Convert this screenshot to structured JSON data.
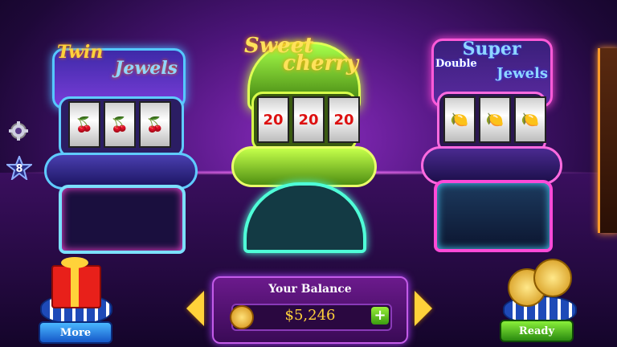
{
  "machines": [
    {
      "title_line1": "Twin",
      "title_line2": "Jewels",
      "reels": [
        "🍒",
        "🍒",
        "🍒"
      ]
    },
    {
      "title_line1": "Sweet",
      "title_line2": "cherry",
      "reels": [
        "20",
        "20",
        "20"
      ]
    },
    {
      "title_line1": "Super",
      "title_line2": "Double",
      "title_line3": "Jewels",
      "reels": [
        "🍋",
        "🍋",
        "🍋"
      ]
    }
  ],
  "sidebar": {
    "level": "8"
  },
  "balance": {
    "label": "Your Balance",
    "amount": "$5,246",
    "add_symbol": "+"
  },
  "buttons": {
    "more_label": "More",
    "ready_label": "Ready"
  },
  "icons": {
    "settings": "gear-icon",
    "level": "star-icon",
    "coin": "coin-icon",
    "gift": "gift-icon",
    "left": "left-arrow-icon",
    "right": "right-arrow-icon"
  },
  "colors": {
    "accent_green": "#7ee23a",
    "accent_blue": "#2aa0ff",
    "gold": "#f4c33a",
    "purple": "#7a23b0"
  }
}
